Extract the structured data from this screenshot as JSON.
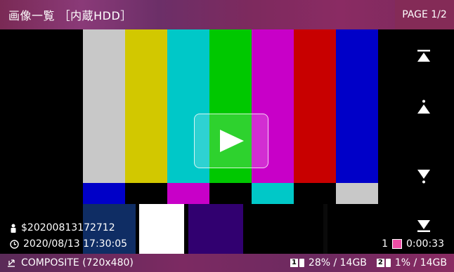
{
  "header": {
    "title": "画像一覧 ［内蔵HDD］",
    "page": "PAGE 1/2"
  },
  "video": {
    "play_icon": "play-icon",
    "top_bars": [
      "#c8c8c8",
      "#d2c800",
      "#00c8c8",
      "#00c800",
      "#c800c8",
      "#c80000",
      "#0000c8"
    ],
    "mid_bars": [
      "#0000c8",
      "#000000",
      "#c800c8",
      "#000000",
      "#00c8c8",
      "#000000",
      "#c8c8c8"
    ],
    "bottom_bars": [
      "#0f2d64",
      "#ffffff",
      "#310070",
      "#000000",
      "#000000",
      "#000000",
      "#000000"
    ]
  },
  "nav": {
    "first_icon": "skip-to-top-icon",
    "prev_icon": "page-up-icon",
    "next_icon": "page-down-icon",
    "last_icon": "skip-to-bottom-icon"
  },
  "info": {
    "name_icon": "person-icon",
    "name": "$20200813172712",
    "date_icon": "clock-icon",
    "datetime": "2020/08/13 17:30:05"
  },
  "clip": {
    "number": "1",
    "duration": "0:00:33",
    "thumb_icon": "clip-thumbnail-icon"
  },
  "footer": {
    "input_icon": "input-source-icon",
    "input": "COMPOSITE (720x480)",
    "drive1_num": "1",
    "drive1_usage": "28% / 14GB",
    "drive2_num": "2",
    "drive2_usage": "1% / 14GB"
  }
}
